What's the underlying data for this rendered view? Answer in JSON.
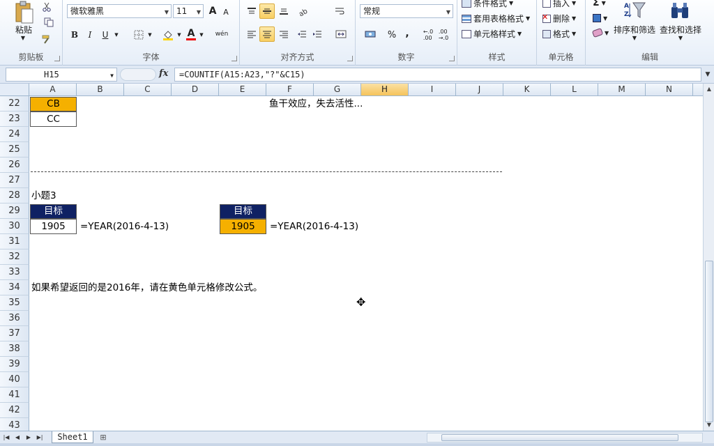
{
  "ribbon": {
    "clipboard": {
      "label": "剪贴板",
      "paste": "粘贴"
    },
    "font": {
      "label": "字体",
      "name": "微软雅黑",
      "size": "11",
      "bold": "B",
      "italic": "I",
      "underline": "U",
      "grow": "A",
      "shrink": "A",
      "font_color_glyph": "A",
      "wen": "wén"
    },
    "alignment": {
      "label": "对齐方式"
    },
    "number": {
      "label": "数字",
      "format": "常规",
      "percent": "%",
      "comma": ","
    },
    "styles": {
      "label": "样式",
      "conditional": "条件格式",
      "table_format": "套用表格格式",
      "cell_styles": "单元格样式"
    },
    "cells": {
      "label": "单元格",
      "insert": "插入",
      "delete": "删除",
      "format": "格式"
    },
    "editing": {
      "label": "编辑",
      "sort_filter": "排序和筛选",
      "find_select": "查找和选择",
      "sigma": "Σ"
    }
  },
  "formula_bar": {
    "name_box": "H15",
    "fx": "fx",
    "formula": "=COUNTIF(A15:A23,\"?\"&C15)"
  },
  "grid": {
    "columns": [
      "A",
      "B",
      "C",
      "D",
      "E",
      "F",
      "G",
      "H",
      "I",
      "J",
      "K",
      "L",
      "M",
      "N"
    ],
    "selected_column": "H",
    "rows": [
      "22",
      "23",
      "24",
      "25",
      "26",
      "27",
      "28",
      "29",
      "30",
      "31",
      "32",
      "33",
      "34",
      "35",
      "36",
      "37",
      "38",
      "39",
      "40",
      "41",
      "42",
      "43"
    ],
    "cells": {
      "a22": "CB",
      "a23": "CC",
      "f22_note": "鱼干效应，失去活性...",
      "a28": "小题3",
      "a29": "目标",
      "a30": "1905",
      "b30": "=YEAR(2016-4-13)",
      "e29": "目标",
      "e30": "1905",
      "f30": "=YEAR(2016-4-13)",
      "a34": "如果希望返回的是2016年，请在黄色单元格修改公式。"
    },
    "colors": {
      "header_fill": "#0f2163",
      "yellow_fill": "#f5b000",
      "selected_header": "#f5c35b"
    }
  },
  "tabs": {
    "sheet": "Sheet1"
  }
}
